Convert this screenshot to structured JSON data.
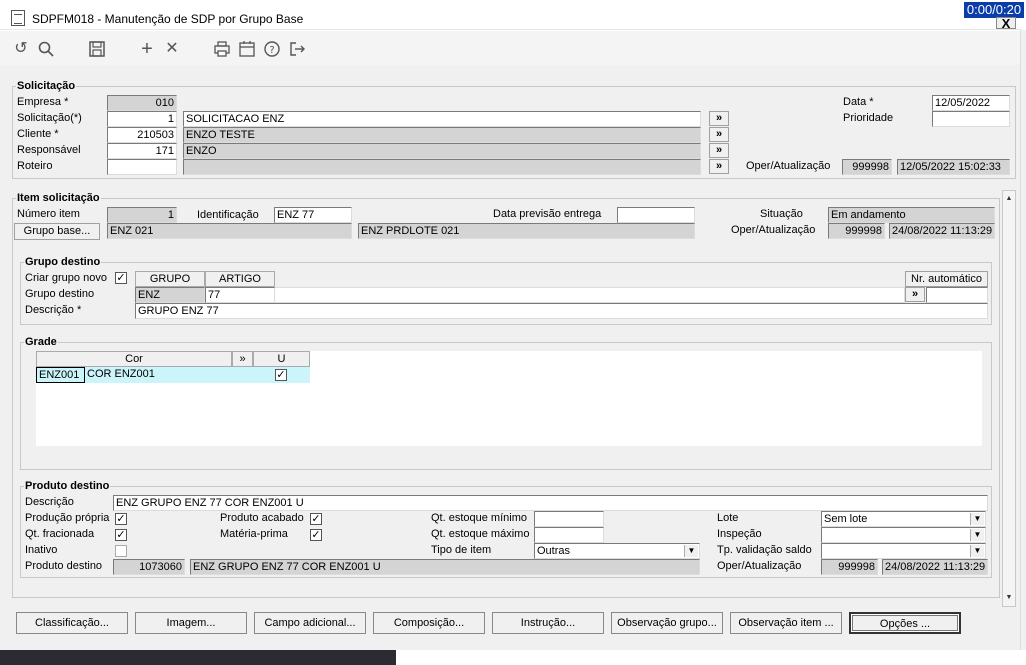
{
  "window": {
    "title": "SDPFM018 - Manutenção de SDP por Grupo Base",
    "timer": "0:00/0:20",
    "close_label": "X"
  },
  "toolbar": {
    "icons": [
      "undo-icon",
      "search-icon",
      "save-icon",
      "add-icon",
      "delete-icon",
      "print-icon",
      "calendar-icon",
      "help-icon",
      "exit-icon"
    ]
  },
  "solicitacao": {
    "title": "Solicitação",
    "empresa_label": "Empresa *",
    "empresa_value": "010",
    "solicitacao_label": "Solicitação(*)",
    "solicitacao_num": "1",
    "solicitacao_desc": "SOLICITACAO ENZ",
    "cliente_label": "Cliente *",
    "cliente_num": "210503",
    "cliente_desc": "ENZO TESTE",
    "responsavel_label": "Responsável",
    "responsavel_num": "171",
    "responsavel_desc": "ENZO",
    "roteiro_label": "Roteiro",
    "roteiro_num": "",
    "roteiro_desc": "",
    "data_label": "Data *",
    "data_value": "12/05/2022",
    "prioridade_label": "Prioridade",
    "prioridade_value": "",
    "oper_label": "Oper/Atualização",
    "oper_user": "999998",
    "oper_datetime": "12/05/2022 15:02:33",
    "arrow_label": "»"
  },
  "item": {
    "title": "Item solicitação",
    "numero_label": "Número item",
    "numero_value": "1",
    "identificacao_label": "Identificação",
    "identificacao_value": "ENZ 77",
    "data_prev_label": "Data previsão entrega",
    "data_prev_value": "",
    "situacao_label": "Situação",
    "situacao_value": "Em andamento",
    "grupo_base_btn": "Grupo base...",
    "grupo_base_code": "ENZ 021",
    "grupo_base_desc": "ENZ PRDLOTE 021",
    "oper_label": "Oper/Atualização",
    "oper_user": "999998",
    "oper_datetime": "24/08/2022 11:13:29"
  },
  "grupo_destino": {
    "title": "Grupo destino",
    "criar_label": "Criar grupo novo",
    "criar_checked": "✓",
    "col_grupo": "GRUPO",
    "col_artigo": "ARTIGO",
    "grupo_label": "Grupo destino",
    "grupo_value": "ENZ",
    "artigo_value": "77",
    "descricao_label": "Descrição *",
    "descricao_value": "GRUPO ENZ 77",
    "nr_auto_btn": "Nr. automático",
    "arrow_label": "»"
  },
  "grade": {
    "title": "Grade",
    "col_cor": "Cor",
    "col_arrow": "»",
    "col_u": "U",
    "rows": [
      {
        "code": "ENZ001",
        "desc": "COR ENZ001",
        "u": "✓"
      }
    ]
  },
  "produto": {
    "title": "Produto destino",
    "descricao_label": "Descrição",
    "descricao_value": "ENZ GRUPO ENZ 77 COR ENZ001 U",
    "producao_propria_label": "Produção própria",
    "producao_propria": "✓",
    "qt_fracionada_label": "Qt. fracionada",
    "qt_fracionada": "✓",
    "inativo_label": "Inativo",
    "inativo": "",
    "produto_acabado_label": "Produto acabado",
    "produto_acabado": "✓",
    "materia_prima_label": "Matéria-prima",
    "materia_prima": "✓",
    "qt_min_label": "Qt. estoque mínimo",
    "qt_min_value": "",
    "qt_max_label": "Qt. estoque máximo",
    "qt_max_value": "",
    "tipo_item_label": "Tipo de item",
    "tipo_item_value": "Outras",
    "lote_label": "Lote",
    "lote_value": "Sem lote",
    "inspecao_label": "Inspeção",
    "inspecao_value": "",
    "tp_validacao_label": "Tp. validação saldo",
    "tp_validacao_value": "",
    "produto_destino_label": "Produto destino",
    "produto_destino_num": "1073060",
    "produto_destino_desc": "ENZ GRUPO ENZ 77 COR ENZ001 U",
    "oper_label": "Oper/Atualização",
    "oper_user": "999998",
    "oper_datetime": "24/08/2022 11:13:29"
  },
  "buttons": {
    "classificacao": "Classificação...",
    "imagem": "Imagem...",
    "campo_adicional": "Campo adicional...",
    "composicao": "Composição...",
    "instrucao": "Instrução...",
    "observacao_grupo": "Observação grupo...",
    "observacao_item": "Observação item ...",
    "opcoes": "Opções ..."
  }
}
